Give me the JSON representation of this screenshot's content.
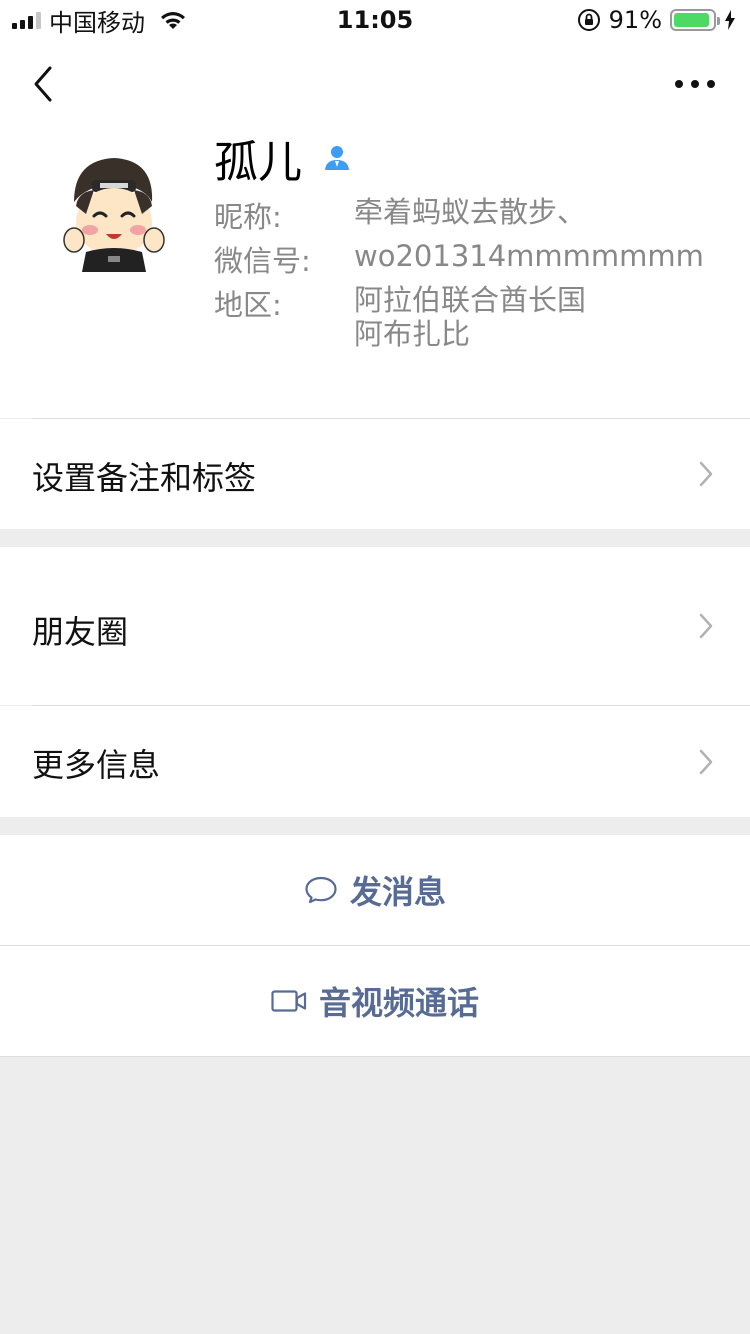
{
  "status_bar": {
    "carrier": "中国移动",
    "time": "11:05",
    "battery_percent": "91%",
    "battery_level": 0.91,
    "icons": [
      "signal-icon",
      "wifi-icon",
      "rotation-lock-icon",
      "battery-icon",
      "charging-bolt-icon"
    ]
  },
  "nav": {
    "back_icon": "chevron-left-icon",
    "more_icon": "more-dots-icon"
  },
  "profile": {
    "name": "孤儿",
    "badge_icon": "contact-person-icon",
    "nickname_label": "昵称:",
    "nickname": "牵着蚂蚁去散步、",
    "wechat_id_label": "微信号:",
    "wechat_id": "wo201314mmmmmmm",
    "region_label": "地区:",
    "region_line1": "阿拉伯联合酋长国",
    "region_line2": "阿布扎比"
  },
  "menu": {
    "remark_tags": "设置备注和标签",
    "moments": "朋友圈",
    "more_info": "更多信息"
  },
  "actions": {
    "send_message": "发消息",
    "voice_video_call": "音视频通话"
  },
  "colors": {
    "accent_link": "#576b95",
    "badge_blue": "#3d9df3",
    "battery_green": "#4cd964",
    "background": "#ededed"
  }
}
